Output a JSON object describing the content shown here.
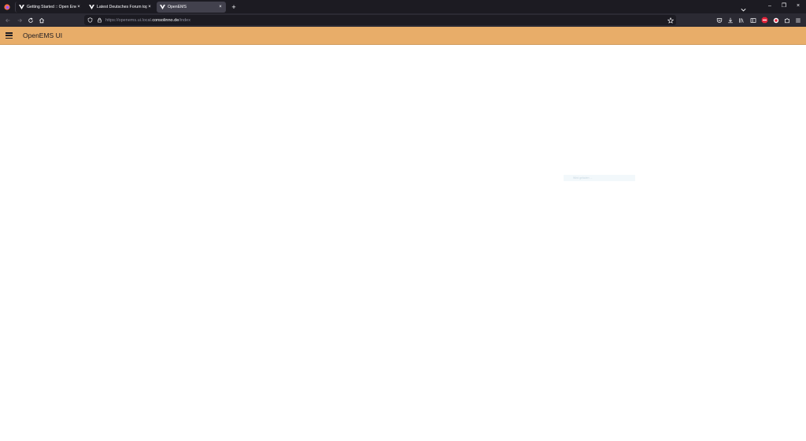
{
  "browser": {
    "tabs": [
      {
        "title": "Getting Started :: Open Energy",
        "active": false
      },
      {
        "title": "Latest Deutsches Forum topics",
        "active": false
      },
      {
        "title": "OpenEMS",
        "active": true
      }
    ],
    "url": {
      "prefix": "https://openems.ui.local.",
      "domain": "consolinno.de",
      "path": "/index"
    },
    "close_symbol": "×",
    "new_tab_symbol": "+",
    "window_controls": {
      "minimize": "–",
      "maximize": "❐",
      "close": "×"
    }
  },
  "app": {
    "title": "OpenEMS UI",
    "accent_color": "#e8ad69"
  },
  "loading_hint": {
    "text": "Wird geladen ..."
  }
}
